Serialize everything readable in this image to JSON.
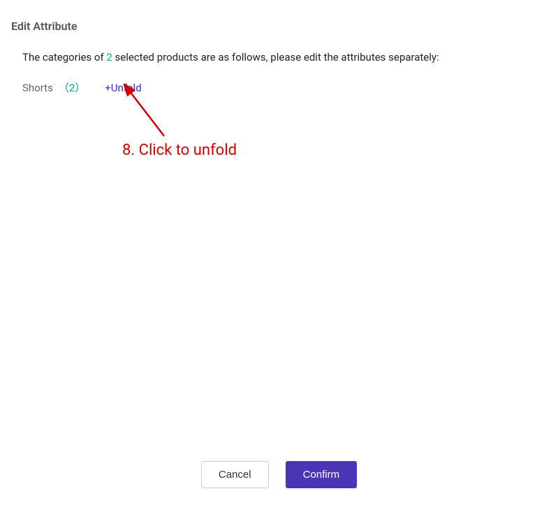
{
  "dialog": {
    "title": "Edit Attribute"
  },
  "instruction": {
    "prefix": "The categories of ",
    "count": "2",
    "suffix": " selected products are as follows, please edit the attributes separately:"
  },
  "category": {
    "name": "Shorts",
    "count": "（2）",
    "unfold": "+Unfold"
  },
  "annotation": {
    "text": "8. Click to unfold"
  },
  "footer": {
    "cancel": "Cancel",
    "confirm": "Confirm"
  },
  "corner_marks": {
    "tr": "",
    "bl": "",
    "br": ""
  }
}
